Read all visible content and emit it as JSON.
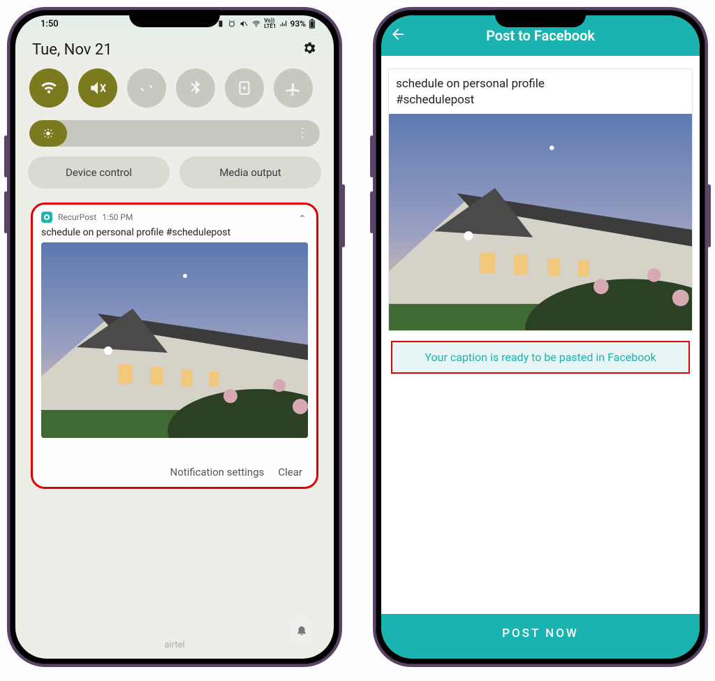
{
  "left": {
    "status": {
      "time": "1:50",
      "battery": "93%"
    },
    "date": "Tue, Nov 21",
    "chips": {
      "device_control": "Device control",
      "media_output": "Media output"
    },
    "notification": {
      "app": "RecurPost",
      "time": "1:50 PM",
      "text": "schedule on personal profile #schedulepost",
      "settings": "Notification settings",
      "clear": "Clear"
    },
    "carrier": "airtel"
  },
  "right": {
    "header_title": "Post to Facebook",
    "post_text_line1": "schedule on personal profile",
    "post_text_line2": "#schedulepost",
    "caption_banner": "Your caption is ready to be pasted in Facebook",
    "post_now": "POST NOW"
  }
}
